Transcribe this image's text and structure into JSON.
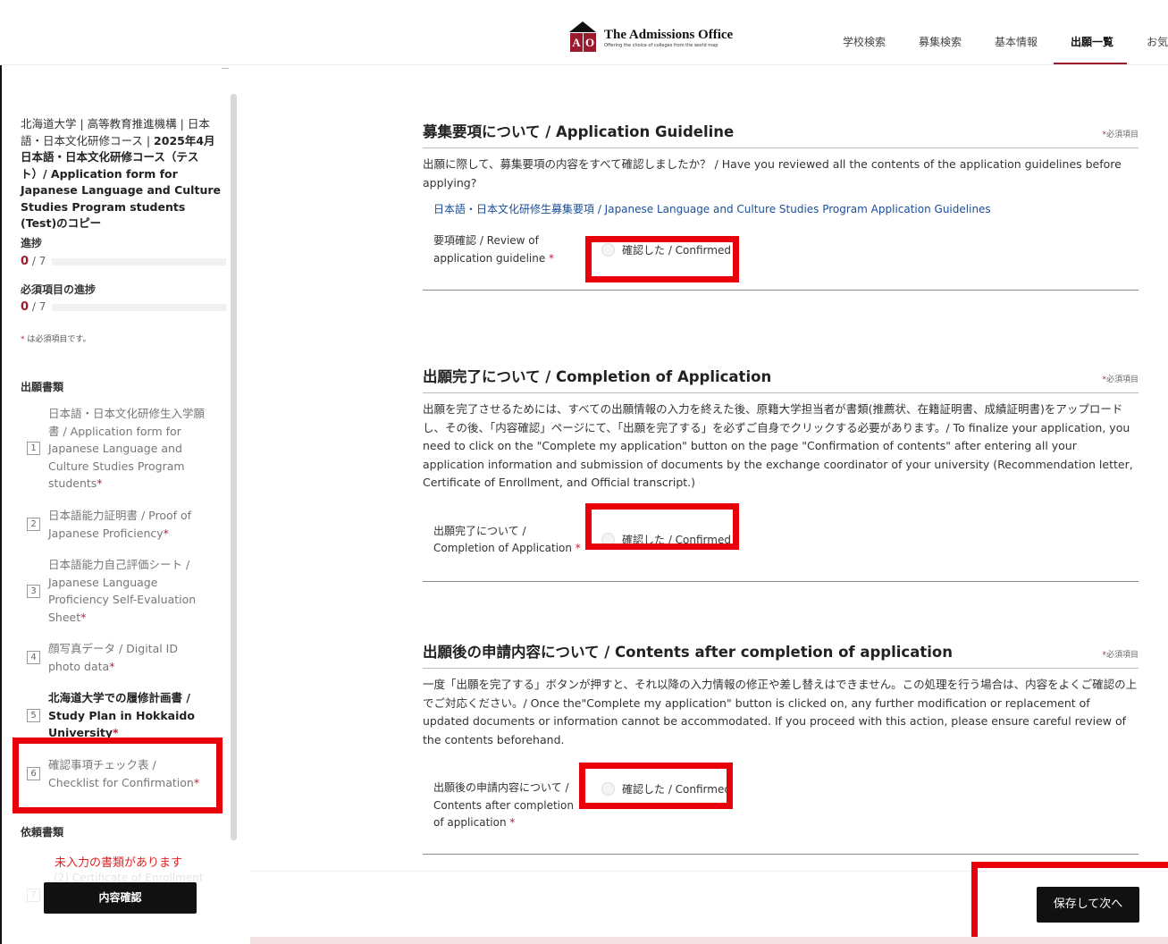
{
  "header": {
    "logo_letters": [
      "A",
      "O"
    ],
    "logo_title": "The Admissions Office",
    "logo_sub": "Offering the choice of colleges from the world map",
    "nav": [
      "学校検索",
      "募集検索",
      "基本情報",
      "出願一覧",
      "お気に"
    ]
  },
  "sidebar": {
    "app_title_line1": "北海道大学 | 高等教育推進機構 | 日本語・日本文化研修コース | ",
    "app_title_bold": "2025年4月 日本語・日本文化研修コース（テスト）/ Application form for Japanese Language and Culture Studies Program students (Test)のコピー",
    "progress_label": "進捗",
    "progress_value": "0",
    "progress_total": " / 7",
    "required_progress_label": "必須項目の進捗",
    "required_progress_value": "0",
    "required_progress_total": " / 7",
    "required_note": "は必須項目です。",
    "docs_heading": "出願書類",
    "docs": [
      {
        "num": "1",
        "label": "日本語・日本文化研修生入学願書 / Application form for Japanese Language and Culture Studies Program students"
      },
      {
        "num": "2",
        "label": "日本語能力証明書 / Proof of Japanese Proficiency"
      },
      {
        "num": "3",
        "label": "日本語能力自己評価シート / Japanese Language Proficiency Self-Evaluation Sheet"
      },
      {
        "num": "4",
        "label": "顔写真データ / Digital ID photo data"
      },
      {
        "num": "5",
        "label": "北海道大学での履修計画書 / Study Plan in Hokkaido University"
      },
      {
        "num": "6",
        "label": "確認事項チェック表 / Checklist for Confirmation"
      }
    ],
    "request_heading": "依頼書類",
    "warning": "未入力の書類があります",
    "ghost_text": "(2) Certificate of Enrollment",
    "ghost_num": "7",
    "confirm_button": "内容確認"
  },
  "main": {
    "required_label": "必須項目",
    "sections": [
      {
        "title": "募集要項について / Application Guideline",
        "desc": "出願に際して、募集要項の内容をすべて確認しましたか？ / Have you reviewed all the contents of the application guidelines before applying?",
        "link": "日本語・日本文化研修生募集要項 / Japanese Language and Culture Studies Program Application Guidelines",
        "field_label": "要項確認 / Review of application guideline",
        "option": "確認した / Confirmed"
      },
      {
        "title": "出願完了について / Completion of Application",
        "desc": "出願を完了させるためには、すべての出願情報の入力を終えた後、原籍大学担当者が書類(推薦状、在籍証明書、成績証明書)をアップロードし、その後、「内容確認」ページにて、「出願を完了する」を必ずご自身でクリックする必要があります。/ To finalize your application, you need to click on the \"Complete my application\" button on the page \"Confirmation of contents\" after entering all your application information and submission of documents by the exchange coordinator of your university (Recommendation letter, Certificate of Enrollment, and Official transcript.)",
        "field_label": "出願完了について / Completion of Application",
        "option": "確認した / Confirmed"
      },
      {
        "title": "出願後の申請内容について / Contents after completion of application",
        "desc": "一度「出願を完了する」ボタンが押すと、それ以降の入力情報の修正や差し替えはできません。この処理を行う場合は、内容をよくご確認の上でご対応ください。/ Once the\"Complete my application\" button is clicked on, any further modification or replacement of updated documents or information cannot be accommodated. If you proceed with this action, please ensure careful review of the contents beforehand.",
        "field_label": "出願後の申請内容について / Contents after completion of application",
        "option": "確認した / Confirmed"
      }
    ],
    "save_button": "保存して次へ"
  },
  "colors": {
    "accent": "#9b1a2d",
    "highlight": "#e8000b",
    "required_star": "#c0203a",
    "link": "#1a4e9a"
  }
}
